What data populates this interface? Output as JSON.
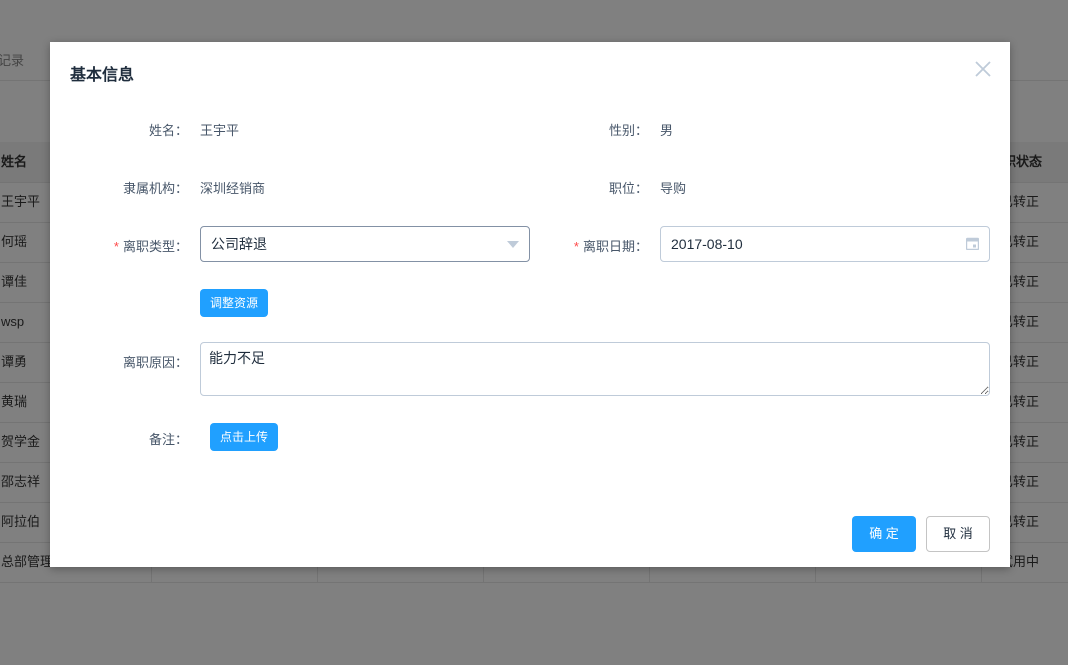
{
  "background": {
    "tab_label": "记录",
    "table": {
      "name_header": "姓名",
      "status_header": "在职状态",
      "names": [
        "王宇平",
        "何瑶",
        "谭佳",
        "wsp",
        "谭勇",
        "黄瑞",
        "贺学金",
        "邵志祥",
        "阿拉伯",
        "总部管理"
      ],
      "statuses": [
        "已转正",
        "已转正",
        "已转正",
        "已转正",
        "已转正",
        "已转正",
        "已转正",
        "已转正",
        "已转正",
        "试用中"
      ]
    }
  },
  "dialog": {
    "title": "基本信息",
    "fields": {
      "name_label": "姓名：",
      "name_value": "王宇平",
      "gender_label": "性别：",
      "gender_value": "男",
      "org_label": "隶属机构：",
      "org_value": "深圳经销商",
      "position_label": "职位：",
      "position_value": "导购",
      "leave_type_label": "离职类型：",
      "leave_type_value": "公司辞退",
      "leave_date_label": "离职日期：",
      "leave_date_value": "2017-08-10",
      "adjust_button": "调整资源",
      "reason_label": "离职原因：",
      "reason_value": "能力不足",
      "remark_label": "备注：",
      "upload_button": "点击上传",
      "required_mark": "*"
    },
    "confirm_button": "确 定",
    "cancel_button": "取 消"
  }
}
